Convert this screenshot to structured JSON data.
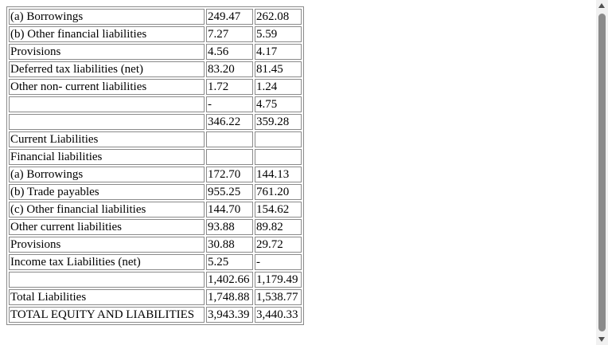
{
  "rows": [
    {
      "label": "(a) Borrowings",
      "v1": "249.47",
      "v2": "262.08"
    },
    {
      "label": "(b) Other financial liabilities",
      "v1": "7.27",
      "v2": "5.59"
    },
    {
      "label": "Provisions",
      "v1": "4.56",
      "v2": "4.17"
    },
    {
      "label": "Deferred tax liabilities (net)",
      "v1": "83.20",
      "v2": "81.45"
    },
    {
      "label": "Other non- current liabilities",
      "v1": "1.72",
      "v2": "1.24"
    },
    {
      "label": "",
      "v1": "-",
      "v2": "4.75"
    },
    {
      "label": "",
      "v1": "346.22",
      "v2": "359.28"
    },
    {
      "label": "Current Liabilities",
      "v1": "",
      "v2": ""
    },
    {
      "label": "Financial liabilities",
      "v1": "",
      "v2": ""
    },
    {
      "label": "(a) Borrowings",
      "v1": "172.70",
      "v2": "144.13"
    },
    {
      "label": "(b) Trade payables",
      "v1": "955.25",
      "v2": "761.20"
    },
    {
      "label": "(c) Other financial liabilities",
      "v1": "144.70",
      "v2": "154.62"
    },
    {
      "label": "Other current liabilities",
      "v1": "93.88",
      "v2": "89.82"
    },
    {
      "label": "Provisions",
      "v1": "30.88",
      "v2": "29.72"
    },
    {
      "label": "Income tax Liabilities (net)",
      "v1": "5.25",
      "v2": "-"
    },
    {
      "label": "",
      "v1": "1,402.66",
      "v2": "1,179.49"
    },
    {
      "label": "Total Liabilities",
      "v1": "1,748.88",
      "v2": "1,538.77"
    },
    {
      "label": "TOTAL EQUITY AND LIABILITIES",
      "v1": "3,943.39",
      "v2": "3,440.33"
    }
  ]
}
